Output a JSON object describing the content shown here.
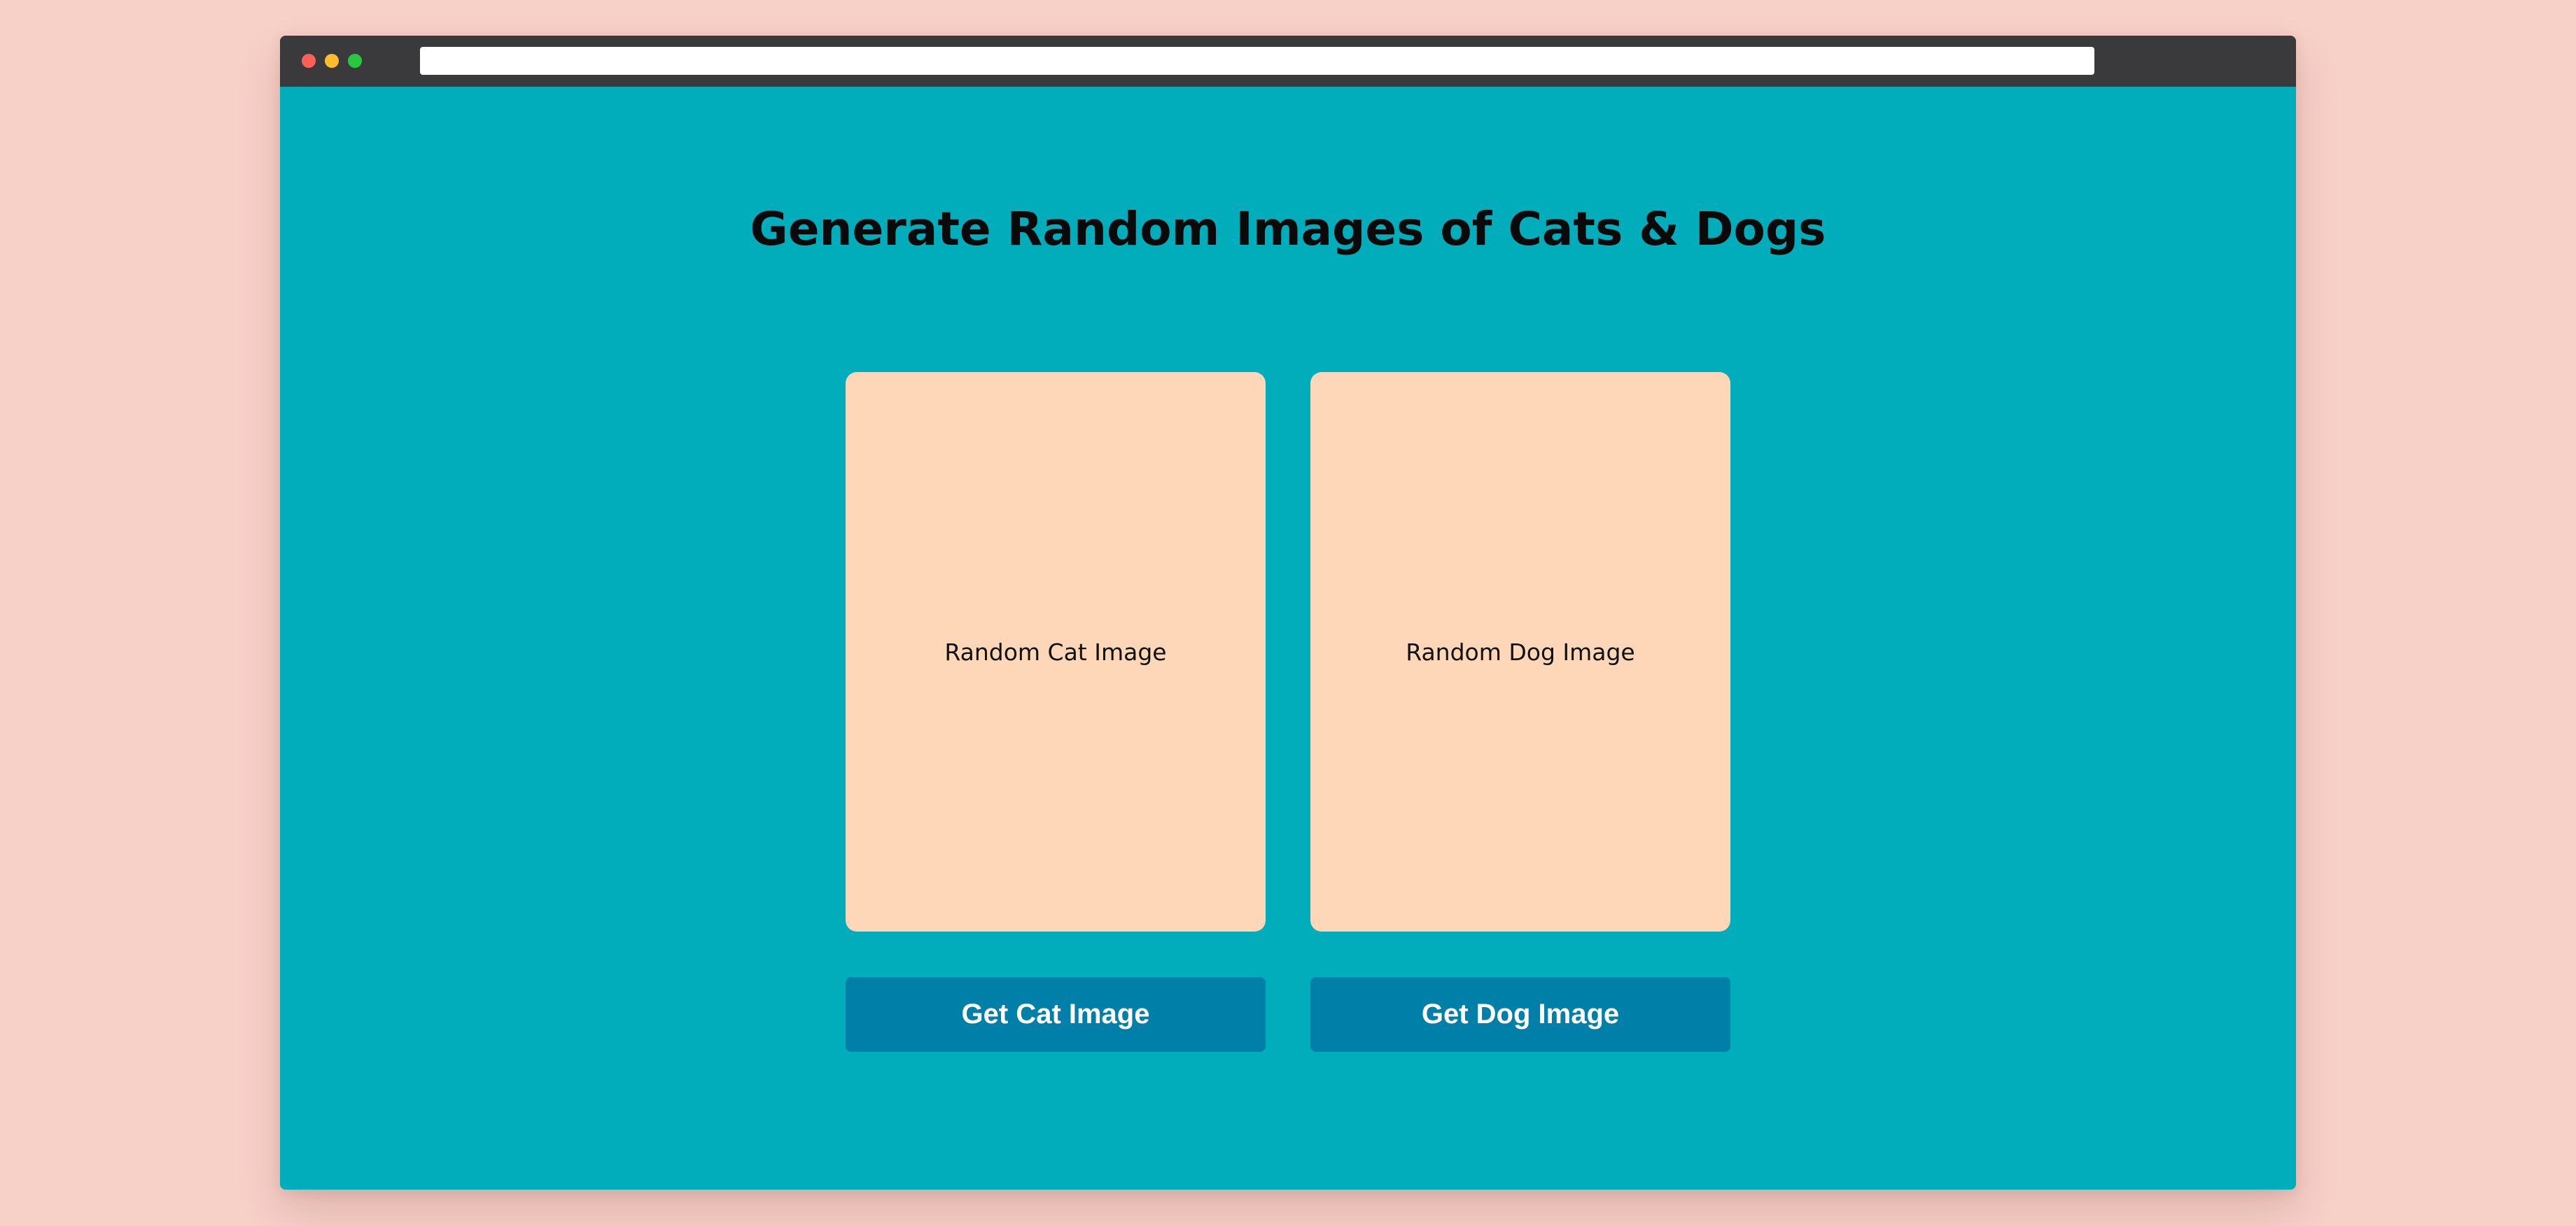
{
  "colors": {
    "page_background": "#f7d0c8",
    "window_background": "#02adbb",
    "titlebar": "#3a3a3c",
    "card_background": "#fdd7b8",
    "button_background": "#0080a8",
    "button_text": "#ffffff"
  },
  "window_controls": {
    "close": "red-dot",
    "minimize": "yellow-dot",
    "maximize": "green-dot"
  },
  "address_bar": {
    "value": ""
  },
  "main": {
    "title": "Generate Random Images of Cats & Dogs",
    "cards": [
      {
        "label": "Random Cat Image"
      },
      {
        "label": "Random Dog Image"
      }
    ],
    "buttons": [
      {
        "label": "Get Cat Image"
      },
      {
        "label": "Get Dog Image"
      }
    ]
  }
}
